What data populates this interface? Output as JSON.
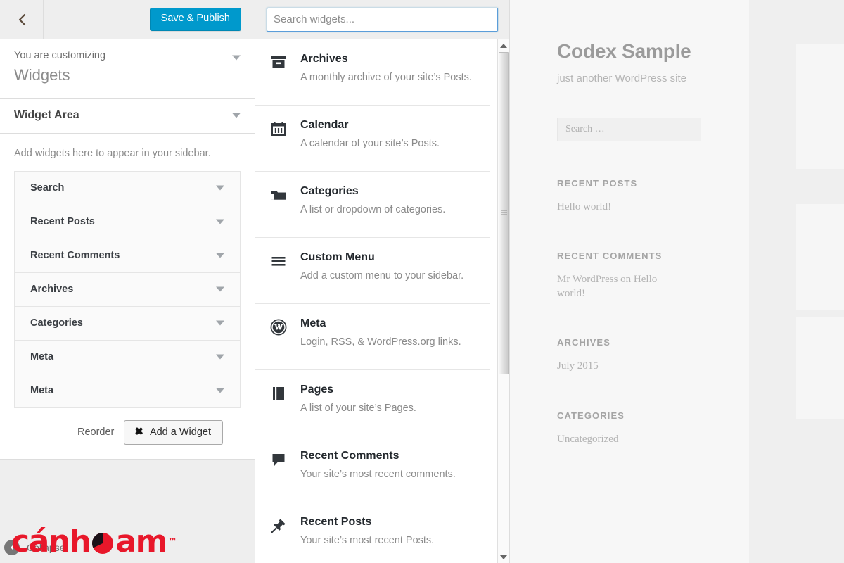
{
  "customizer": {
    "back_icon": "chevron-left-icon",
    "save_label": "Save & Publish",
    "eyebrow": "You are customizing",
    "title": "Widgets",
    "panel_label": "Widget Area",
    "description": "Add widgets here to appear in your sidebar.",
    "widgets": [
      {
        "label": "Search"
      },
      {
        "label": "Recent Posts"
      },
      {
        "label": "Recent Comments"
      },
      {
        "label": "Archives"
      },
      {
        "label": "Categories"
      },
      {
        "label": "Meta"
      },
      {
        "label": "Meta"
      }
    ],
    "reorder_label": "Reorder",
    "add_widget_label": "Add a Widget",
    "add_widget_icon": "x-icon",
    "collapse_label": "Collapse",
    "collapse_icon": "collapse-arrow-icon"
  },
  "chooser": {
    "search_placeholder": "Search widgets...",
    "search_value": "",
    "available": [
      {
        "icon": "archive-box-icon",
        "name": "Archives",
        "desc": "A monthly archive of your site’s Posts."
      },
      {
        "icon": "calendar-icon",
        "name": "Calendar",
        "desc": "A calendar of your site’s Posts."
      },
      {
        "icon": "folder-icon",
        "name": "Categories",
        "desc": "A list or dropdown of categories."
      },
      {
        "icon": "menu-lines-icon",
        "name": "Custom Menu",
        "desc": "Add a custom menu to your sidebar."
      },
      {
        "icon": "wordpress-logo-icon",
        "name": "Meta",
        "desc": "Login, RSS, & WordPress.org links."
      },
      {
        "icon": "pages-icon",
        "name": "Pages",
        "desc": "A list of your site’s Pages."
      },
      {
        "icon": "comment-bubble-icon",
        "name": "Recent Comments",
        "desc": "Your site’s most recent comments."
      },
      {
        "icon": "pushpin-icon",
        "name": "Recent Posts",
        "desc": "Your site’s most recent Posts."
      }
    ]
  },
  "preview": {
    "site_title": "Codex Sample",
    "site_description": "just another WordPress site",
    "search_placeholder": "Search …",
    "widgets": [
      {
        "title": "RECENT POSTS",
        "items": [
          {
            "text": "Hello world!"
          }
        ]
      },
      {
        "title": "RECENT COMMENTS",
        "items": [
          {
            "text": "Mr WordPress on Hello world!"
          }
        ]
      },
      {
        "title": "ARCHIVES",
        "items": [
          {
            "text": "July 2015"
          }
        ]
      },
      {
        "title": "CATEGORIES",
        "items": [
          {
            "text": "Uncategorized"
          }
        ]
      }
    ]
  },
  "watermark": {
    "text_before": "c",
    "text_mid": "nh",
    "text_after": "am",
    "accent_char": "á",
    "trademark": "™",
    "color": "#e8172a"
  },
  "colors": {
    "accent_blue": "#0099cc",
    "panel_bg": "#ffffff",
    "chrome_bg": "#eeeeee",
    "border": "#dddddd",
    "watermark_red": "#e8172a"
  }
}
